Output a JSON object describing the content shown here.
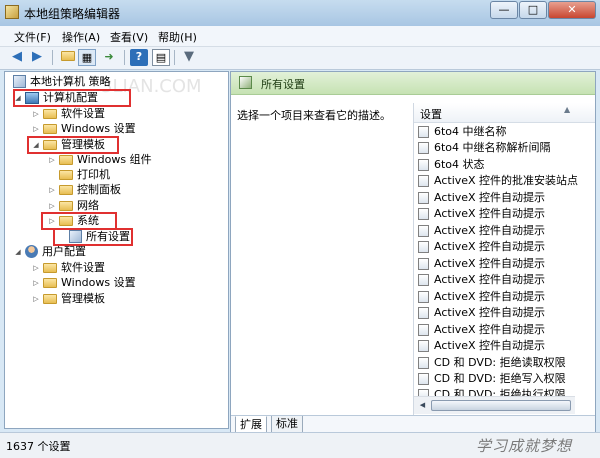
{
  "window": {
    "title": "本地组策略编辑器"
  },
  "menu": [
    "文件(F)",
    "操作(A)",
    "查看(V)",
    "帮助(H)"
  ],
  "toolbar_icons": [
    "back-arrow-icon",
    "forward-arrow-icon",
    "folder-up-icon",
    "show-hide-tree-icon",
    "export-list-icon",
    "help-icon",
    "properties-icon",
    "filter-icon"
  ],
  "watermark": "3LIAN.COM",
  "tree": {
    "root": "本地计算机 策略",
    "computer_config": "计算机配置",
    "software": "软件设置",
    "windows": "Windows 设置",
    "admin_templates": "管理模板",
    "windows_components": "Windows 组件",
    "printers": "打印机",
    "control_panel": "控制面板",
    "network": "网络",
    "system": "系统",
    "all_settings": "所有设置",
    "user_config": "用户配置",
    "user_software": "软件设置",
    "user_windows": "Windows 设置",
    "user_admin_templates": "管理模板"
  },
  "right": {
    "header": "所有设置",
    "description": "选择一个项目来查看它的描述。",
    "column": "设置",
    "items": [
      "6to4 中继名称",
      "6to4 中继名称解析间隔",
      "6to4 状态",
      "ActiveX 控件的批准安装站点",
      "ActiveX 控件自动提示",
      "ActiveX 控件自动提示",
      "ActiveX 控件自动提示",
      "ActiveX 控件自动提示",
      "ActiveX 控件自动提示",
      "ActiveX 控件自动提示",
      "ActiveX 控件自动提示",
      "ActiveX 控件自动提示",
      "ActiveX 控件自动提示",
      "ActiveX 控件自动提示",
      "CD 和 DVD: 拒绝读取权限",
      "CD 和 DVD: 拒绝写入权限",
      "CD 和 DVD: 拒绝执行权限"
    ]
  },
  "tabs": [
    "扩展",
    "标准"
  ],
  "status": {
    "count": "1637 个设置",
    "brand": "学习成就梦想"
  }
}
